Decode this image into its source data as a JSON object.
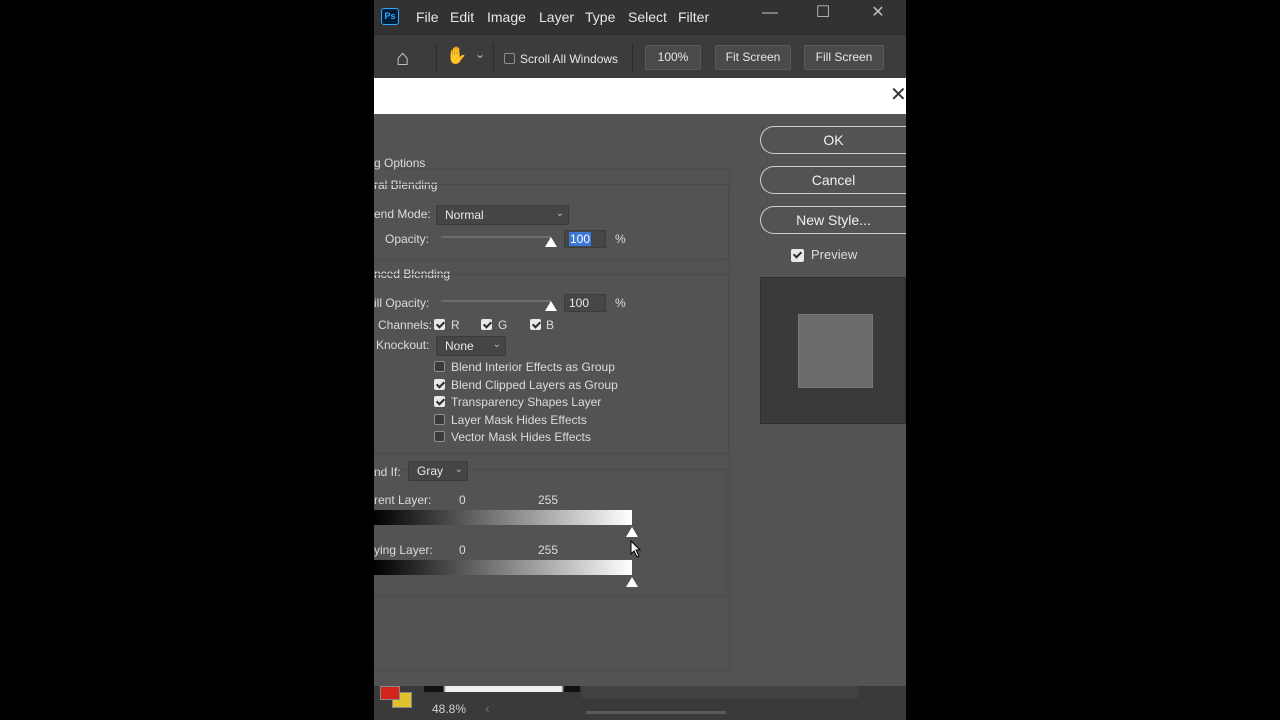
{
  "menubar": {
    "logo": "Ps",
    "items": [
      "File",
      "Edit",
      "Image",
      "Layer",
      "Type",
      "Select",
      "Filter"
    ],
    "minimize": "—",
    "maximize": "☐",
    "close": "✕"
  },
  "options_bar": {
    "home_icon": "⌂",
    "hand_icon": "✋",
    "hand_chevron": "⌄",
    "scroll_all_label": "Scroll All Windows",
    "zoom_100": "100%",
    "fit_screen": "Fit Screen",
    "fill_screen": "Fill Screen"
  },
  "dialog": {
    "close": "✕",
    "section_title": "g Options",
    "general": {
      "title": "ral Blending",
      "blend_mode_label": "end Mode:",
      "blend_mode_value": "Normal",
      "opacity_label": "Opacity:",
      "opacity_value": "100",
      "opacity_unit": "%",
      "opacity_fraction": 1.0
    },
    "advanced": {
      "title": "nced Blending",
      "fill_opacity_label": "ill Opacity:",
      "fill_opacity_value": "100",
      "fill_opacity_unit": "%",
      "channels_label": "Channels:",
      "channels": [
        {
          "label": "R",
          "checked": true
        },
        {
          "label": "G",
          "checked": true
        },
        {
          "label": "B",
          "checked": true
        }
      ],
      "knockout_label": "Knockout:",
      "knockout_value": "None",
      "options": [
        {
          "label": "Blend Interior Effects as Group",
          "checked": false
        },
        {
          "label": "Blend Clipped Layers as Group",
          "checked": true
        },
        {
          "label": "Transparency Shapes Layer",
          "checked": true
        },
        {
          "label": "Layer Mask Hides Effects",
          "checked": false
        },
        {
          "label": "Vector Mask Hides Effects",
          "checked": false
        }
      ]
    },
    "blend_if": {
      "label": "nd If:",
      "value": "Gray",
      "this_layer_label": "rent Layer:",
      "this_layer_low": "0",
      "this_layer_high": "255",
      "underlying_label": "ying Layer:",
      "underlying_low": "0",
      "underlying_high": "255"
    },
    "buttons": {
      "ok": "OK",
      "cancel": "Cancel",
      "new_style": "New Style...",
      "preview_label": "Preview",
      "preview_checked": true
    }
  },
  "status": {
    "zoom": "48.8%",
    "scroll_left": "‹"
  },
  "colors": {
    "foreground": "#d4231a",
    "background": "#e0c22e",
    "accent_selection": "#3b78d6"
  }
}
